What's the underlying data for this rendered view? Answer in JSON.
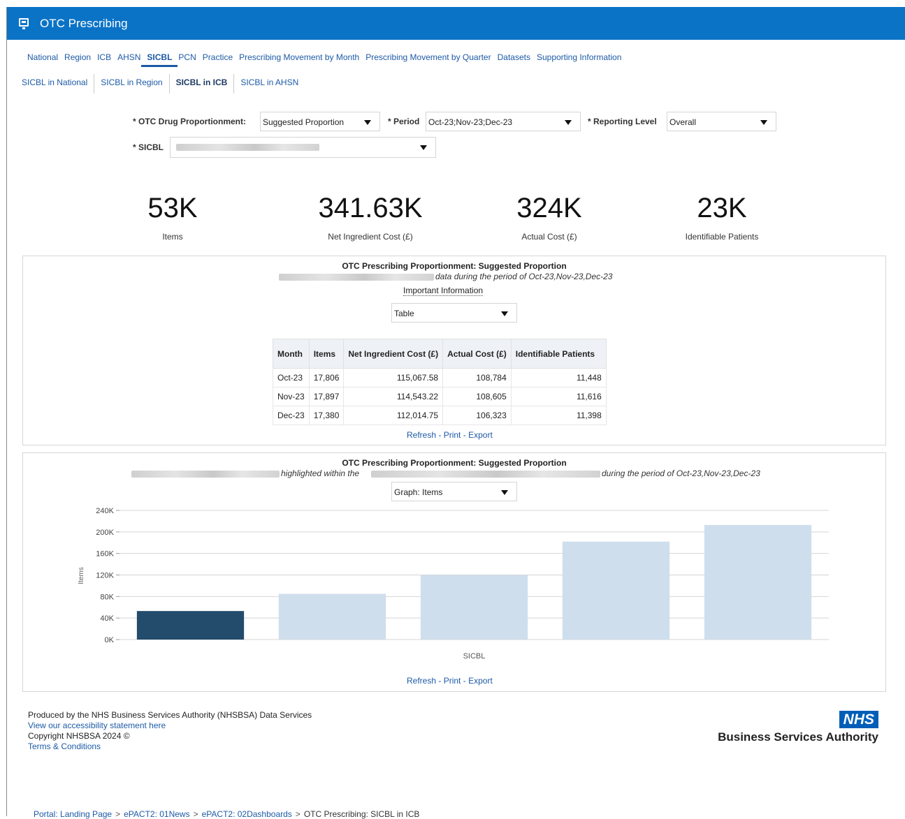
{
  "app": {
    "title": "OTC Prescribing",
    "icon": "presentation-icon"
  },
  "tabs": [
    "National",
    "Region",
    "ICB",
    "AHSN",
    "SICBL",
    "PCN",
    "Practice",
    "Prescribing Movement by Month",
    "Prescribing Movement by Quarter",
    "Datasets",
    "Supporting Information"
  ],
  "active_tab": "SICBL",
  "subtabs": [
    "SICBL in National",
    "SICBL in Region",
    "SICBL in ICB",
    "SICBL in AHSN"
  ],
  "active_subtab": "SICBL in ICB",
  "prompts": {
    "proportionment_label": "* OTC Drug Proportionment:",
    "proportionment_value": "Suggested Proportion",
    "period_label": "* Period",
    "period_value": "Oct-23;Nov-23;Dec-23",
    "reporting_label": "* Reporting Level",
    "reporting_value": "Overall",
    "sicbl_label": "* SICBL",
    "sicbl_value": ""
  },
  "kpis": [
    {
      "value": "53K",
      "label": "Items"
    },
    {
      "value": "341.63K",
      "label": "Net Ingredient Cost (£)"
    },
    {
      "value": "324K",
      "label": "Actual Cost (£)"
    },
    {
      "value": "23K",
      "label": "Identifiable Patients"
    }
  ],
  "table_panel": {
    "title": "OTC Prescribing Proportionment: Suggested Proportion",
    "subtitle": "data during the period of Oct-23,Nov-23,Dec-23",
    "important_info": "Important Information",
    "view_select": "Table",
    "headers": [
      "Month",
      "Items",
      "Net Ingredient Cost (£)",
      "Actual Cost (£)",
      "Identifiable Patients"
    ],
    "rows": [
      [
        "Oct-23",
        "17,806",
        "115,067.58",
        "108,784",
        "11,448"
      ],
      [
        "Nov-23",
        "17,897",
        "114,543.22",
        "108,605",
        "11,616"
      ],
      [
        "Dec-23",
        "17,380",
        "112,014.75",
        "106,323",
        "11,398"
      ]
    ],
    "actions": {
      "refresh": "Refresh",
      "print": "Print",
      "export": "Export"
    }
  },
  "graph_panel": {
    "title": "OTC Prescribing Proportionment: Suggested Proportion",
    "subtitle_mid": "highlighted within the",
    "subtitle_end": "during the period of Oct-23,Nov-23,Dec-23",
    "view_select": "Graph: Items",
    "actions": {
      "refresh": "Refresh",
      "print": "Print",
      "export": "Export"
    }
  },
  "chart_data": {
    "type": "bar",
    "xlabel": "SICBL",
    "ylabel": "Items",
    "ylim": [
      0,
      240000
    ],
    "yticks": [
      "0K",
      "40K",
      "80K",
      "120K",
      "160K",
      "200K",
      "240K"
    ],
    "values": [
      53000,
      85000,
      120000,
      182000,
      213000
    ],
    "highlight_index": 0,
    "colors": {
      "highlight": "#234b6c",
      "other": "#cfdeec"
    },
    "grid": true
  },
  "footer": {
    "produced_by": "Produced by the NHS Business Services Authority (NHSBSA) Data Services",
    "accessibility": "View our accessibility statement here",
    "copyright": "Copyright NHSBSA 2024 ©",
    "terms": "Terms & Conditions",
    "logo_text": "NHS",
    "logo_org": "Business Services Authority"
  },
  "breadcrumb": [
    "Portal: Landing Page",
    "ePACT2: 01News",
    "ePACT2: 02Dashboards",
    "OTC Prescribing: SICBL in ICB"
  ],
  "breadcrumb_separator": ">",
  "colors": {
    "header_bg": "#0b73c6",
    "link": "#1d5aa6",
    "nhs_blue": "#005eb8"
  }
}
